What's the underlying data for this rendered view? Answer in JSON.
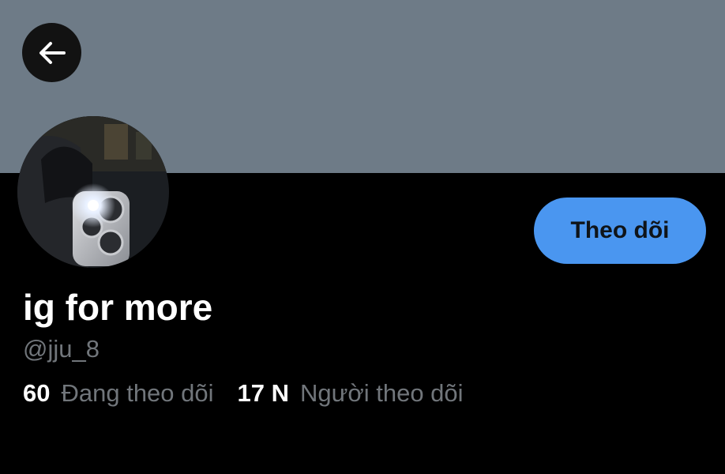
{
  "colors": {
    "banner": "#6e7b87",
    "background": "#000000",
    "accent": "#4a96f0",
    "secondary_text": "#71767b",
    "primary_text": "#ffffff"
  },
  "header": {
    "back_icon": "arrow-left-icon"
  },
  "profile": {
    "display_name": "ig for more",
    "handle": "@jju_8",
    "follow_label": "Theo dõi",
    "following_count": "60",
    "following_label": "Đang theo dõi",
    "followers_count": "17 N",
    "followers_label": "Người theo dõi"
  }
}
